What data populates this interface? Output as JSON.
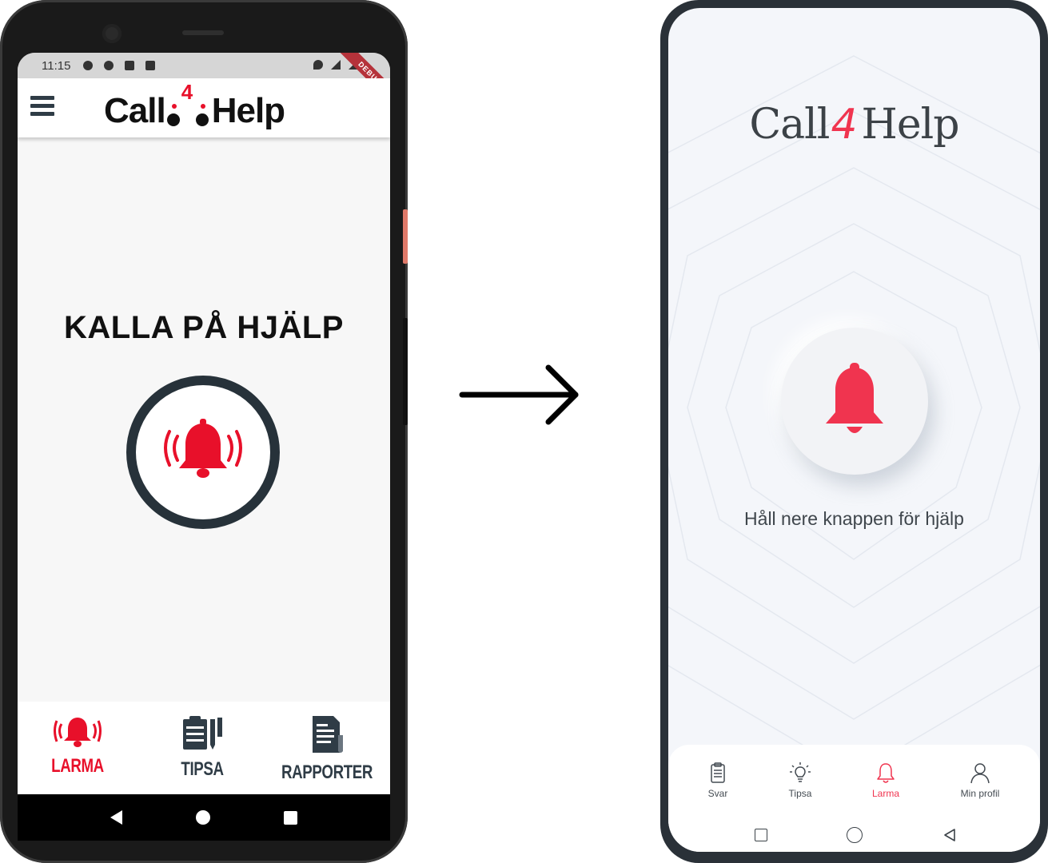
{
  "old_design": {
    "status_bar": {
      "time": "11:15",
      "debug_badge": "DEBUG"
    },
    "app_bar": {
      "logo_prefix": "Call",
      "logo_digit": "4",
      "logo_suffix": "Help"
    },
    "heading": "KALLA PÅ HJÄLP",
    "alarm_icon": "alarm-bell-icon",
    "nav": [
      {
        "label": "LARMA",
        "icon": "bell-icon",
        "active": true
      },
      {
        "label": "TIPSA",
        "icon": "clipboard-icon",
        "active": false
      },
      {
        "label": "RAPPORTER",
        "icon": "report-icon",
        "active": false
      }
    ]
  },
  "new_design": {
    "logo": {
      "prefix": "Call",
      "digit": "4",
      "suffix": "Help"
    },
    "caption": "Håll nere knappen för hjälp",
    "nav": [
      {
        "label": "Svar",
        "icon": "clipboard-icon",
        "active": false
      },
      {
        "label": "Tipsa",
        "icon": "lightbulb-icon",
        "active": false
      },
      {
        "label": "Larma",
        "icon": "bell-icon",
        "active": true
      },
      {
        "label": "Min profil",
        "icon": "person-icon",
        "active": false
      }
    ]
  },
  "colors": {
    "old_accent": "#e8102a",
    "old_dark": "#27323a",
    "new_accent": "#f0344f",
    "new_bg": "#f4f6fa"
  }
}
